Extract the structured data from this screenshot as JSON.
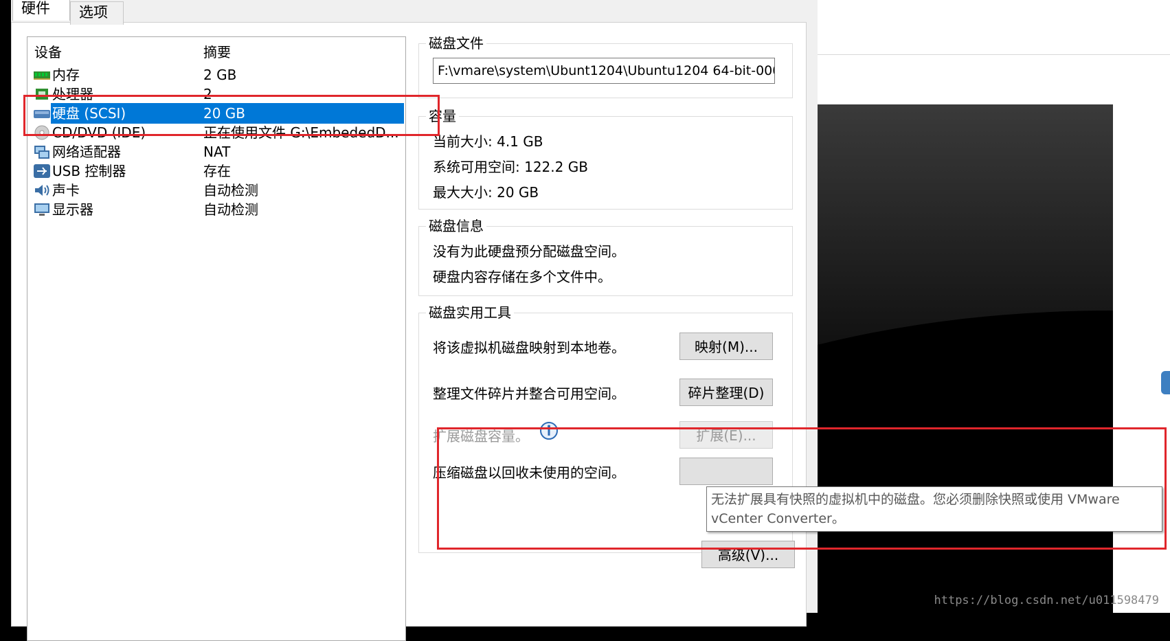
{
  "tabs": [
    "硬件",
    "选项"
  ],
  "device_list": {
    "headers": {
      "device": "设备",
      "summary": "摘要"
    },
    "rows": [
      {
        "name": "内存",
        "summary": "2 GB",
        "icon": "memory-icon"
      },
      {
        "name": "处理器",
        "summary": "2",
        "icon": "processor-icon"
      },
      {
        "name": "硬盘 (SCSI)",
        "summary": "20 GB",
        "icon": "hard-disk-icon",
        "selected": true
      },
      {
        "name": "CD/DVD (IDE)",
        "summary": "正在使用文件 G:\\EmbededD...",
        "icon": "cd-dvd-icon"
      },
      {
        "name": "网络适配器",
        "summary": "NAT",
        "icon": "network-adapter-icon"
      },
      {
        "name": "USB 控制器",
        "summary": "存在",
        "icon": "usb-icon"
      },
      {
        "name": "声卡",
        "summary": "自动检测",
        "icon": "sound-card-icon"
      },
      {
        "name": "显示器",
        "summary": "自动检测",
        "icon": "display-icon"
      }
    ]
  },
  "disk_file": {
    "title": "磁盘文件",
    "path": "F:\\vmare\\system\\Ubunt1204\\Ubuntu1204 64-bit-000("
  },
  "capacity": {
    "title": "容量",
    "current": "当前大小: 4.1 GB",
    "available": "系统可用空间: 122.2 GB",
    "max": "最大大小: 20 GB"
  },
  "disk_info": {
    "title": "磁盘信息",
    "line1": "没有为此硬盘预分配磁盘空间。",
    "line2": "硬盘内容存储在多个文件中。"
  },
  "utilities": {
    "title": "磁盘实用工具",
    "map_text": "将该虚拟机磁盘映射到本地卷。",
    "map_btn": "映射(M)...",
    "defrag_text": "整理文件碎片并整合可用空间。",
    "defrag_btn": "碎片整理(D)",
    "expand_text": "扩展磁盘容量。",
    "expand_btn": "扩展(E)...",
    "compact_text": "压缩磁盘以回收未使用的空间。"
  },
  "advanced_btn": "高级(V)...",
  "tooltip": {
    "line1": "无法扩展具有快照的虚拟机中的磁盘。您必须删除快照或使用 VMware",
    "line2": "vCenter Converter。"
  },
  "watermark": "https://blog.csdn.net/u011598479",
  "colors": {
    "selection": "#0078d7",
    "highlight_box": "#e0262b"
  }
}
